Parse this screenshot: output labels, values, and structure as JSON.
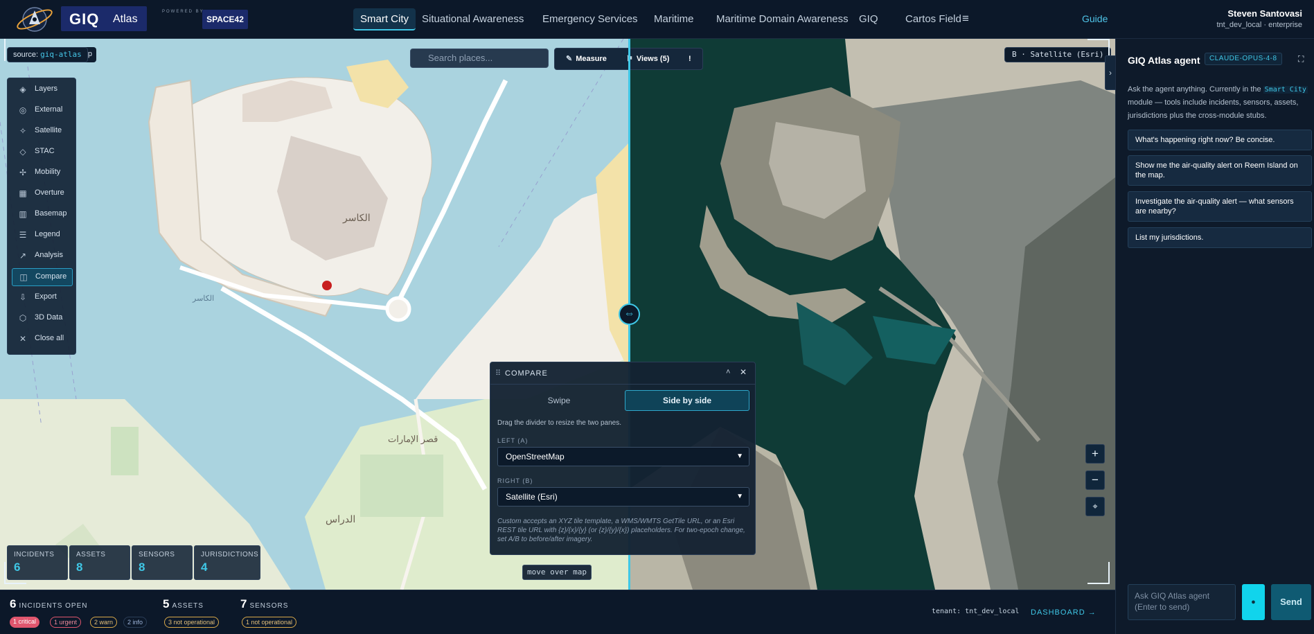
{
  "app": {
    "brand": "GIQ",
    "product": "Atlas",
    "powered_by": "POWERED BY",
    "partner": "SPACE42"
  },
  "nav": {
    "tabs": [
      {
        "label": "Smart City",
        "active": true
      },
      {
        "label": "Situational Awareness"
      },
      {
        "label": "Emergency Services"
      },
      {
        "label": "Maritime"
      },
      {
        "label": "Maritime Domain Awareness"
      },
      {
        "label": "GIQ"
      },
      {
        "label": "Cartos Field"
      }
    ],
    "more_icon": "hamburger-icon",
    "guide": "Guide"
  },
  "user": {
    "name": "Steven Santovasi",
    "tenant": "tnt_dev_local · enterprise"
  },
  "map": {
    "source_label": "source:",
    "source_value": "giq-atlas",
    "source_ghost": "ap",
    "search_placeholder": "Search places...",
    "toolbar": {
      "measure": "Measure",
      "views": "Views (5)",
      "alert": "!"
    },
    "right_label": "B · Satellite (Esri)",
    "mouse_hint": "move over map",
    "tools": [
      {
        "icon": "layers-icon",
        "label": "Layers"
      },
      {
        "icon": "globe-icon",
        "label": "External"
      },
      {
        "icon": "satellite-icon",
        "label": "Satellite"
      },
      {
        "icon": "stack-icon",
        "label": "STAC"
      },
      {
        "icon": "mobility-icon",
        "label": "Mobility"
      },
      {
        "icon": "grid-icon",
        "label": "Overture"
      },
      {
        "icon": "map-icon",
        "label": "Basemap"
      },
      {
        "icon": "list-icon",
        "label": "Legend"
      },
      {
        "icon": "chart-icon",
        "label": "Analysis"
      },
      {
        "icon": "compare-icon",
        "label": "Compare",
        "active": true
      },
      {
        "icon": "export-icon",
        "label": "Export"
      },
      {
        "icon": "cube-icon",
        "label": "3D Data"
      },
      {
        "icon": "close-icon",
        "label": "Close all"
      }
    ],
    "stats": [
      {
        "label": "INCIDENTS",
        "value": "6"
      },
      {
        "label": "ASSETS",
        "value": "8"
      },
      {
        "label": "SENSORS",
        "value": "8"
      },
      {
        "label": "JURISDICTIONS",
        "value": "4"
      }
    ],
    "map_labels": {
      "l1": "الكاسر",
      "l2": "قصر الإمارات",
      "l3": "الكاسر",
      "l4": "الدراس"
    }
  },
  "compare": {
    "title": "COMPARE",
    "modes": {
      "swipe": "Swipe",
      "side": "Side by side"
    },
    "hint": "Drag the divider to resize the two panes.",
    "left_label": "LEFT (A)",
    "left_value": "OpenStreetMap",
    "right_label": "RIGHT (B)",
    "right_value": "Satellite (Esri)",
    "note": "Custom accepts an XYZ tile template, a WMS/WMTS GetTile URL, or an Esri REST tile URL with {z}/{x}/{y} (or {z}/{y}/{x}) placeholders. For two-epoch change, set A/B to before/after imagery."
  },
  "agent": {
    "title": "GIQ Atlas agent",
    "model": "CLAUDE-OPUS-4-8",
    "intro_a": "Ask the agent anything. Currently in the ",
    "intro_module": "Smart City",
    "intro_b": " module — tools include incidents, sensors, assets, jurisdictions plus the cross-module stubs.",
    "suggestions": [
      "What's happening right now? Be concise.",
      "Show me the air-quality alert on Reem Island on the map.",
      "Investigate the air-quality alert — what sensors are nearby?",
      "List my jurisdictions."
    ],
    "input_placeholder": "Ask GIQ Atlas agent (Enter to send)",
    "send": "Send"
  },
  "status": {
    "incidents": {
      "num": "6",
      "label": "INCIDENTS OPEN"
    },
    "assets": {
      "num": "5",
      "label": "ASSETS"
    },
    "sensors": {
      "num": "7",
      "label": "SENSORS"
    },
    "badges": {
      "critical": "1 critical",
      "urgent": "1 urgent",
      "warn": "2 warn",
      "info": "2 info",
      "assets_not_op": "3 not operational",
      "sensors_not_op": "1 not operational"
    },
    "tenant": "tenant: tnt_dev_local",
    "dashboard": "DASHBOARD →"
  },
  "colors": {
    "accent": "#3fc7e6",
    "critical": "#e0566e",
    "urgent": "#e0566e",
    "warn": "#d9a94a",
    "info": "#5b8fd6"
  }
}
